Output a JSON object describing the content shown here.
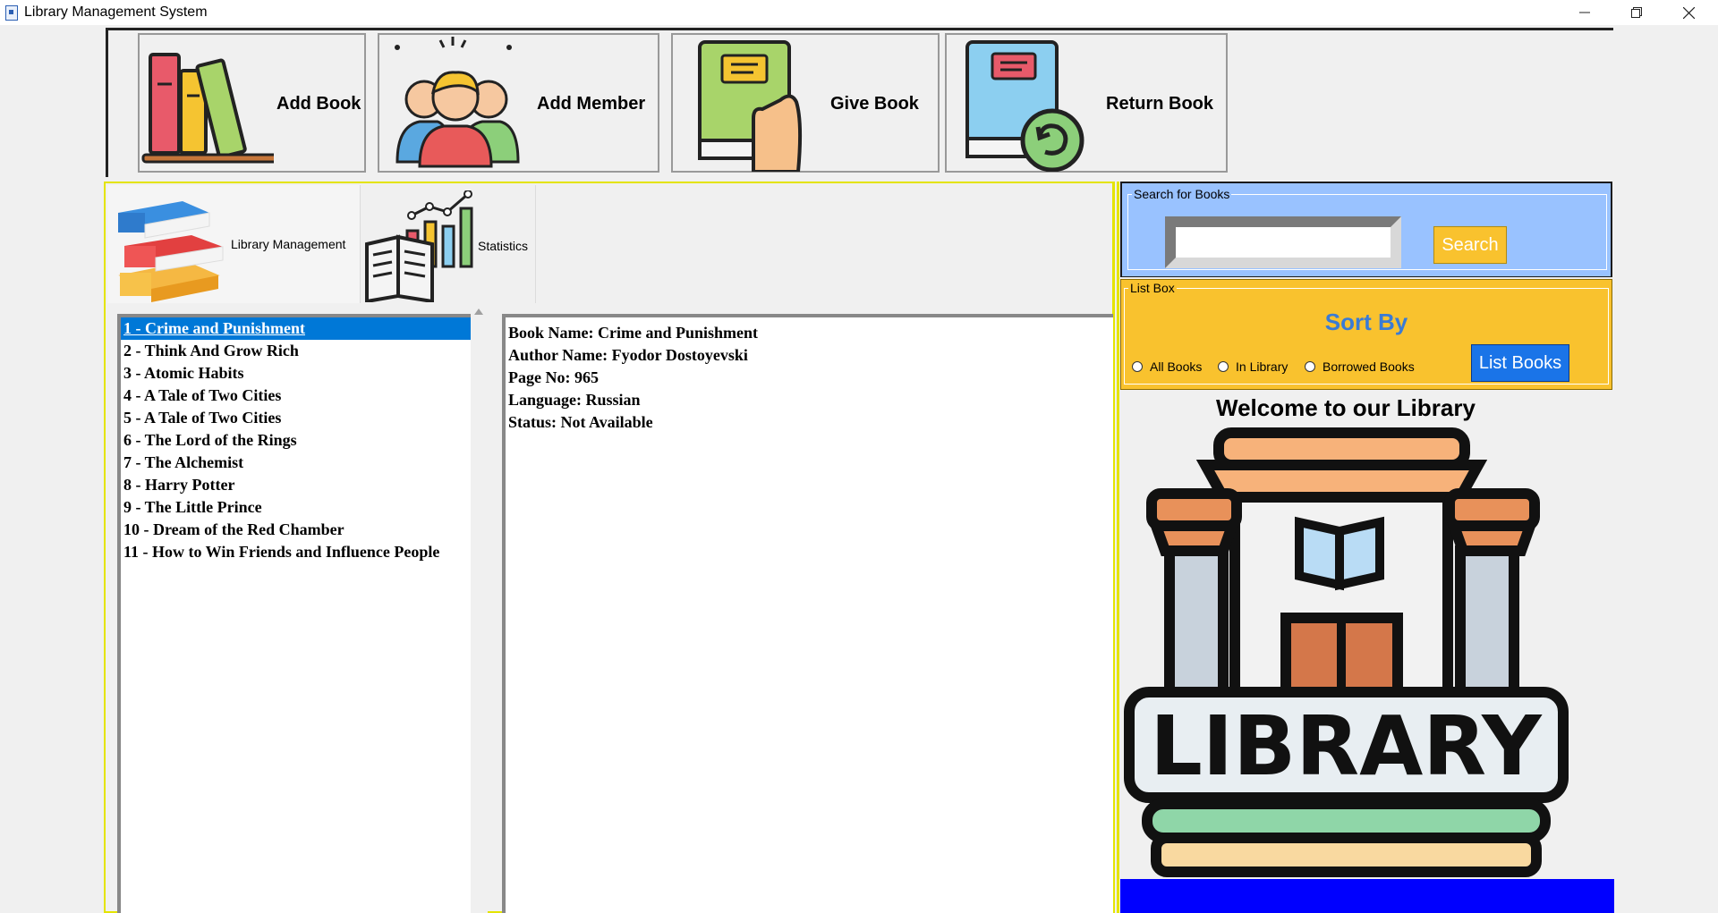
{
  "window": {
    "title": "Library Management System",
    "controls": [
      "minimize",
      "restore",
      "close"
    ]
  },
  "toolbar": {
    "buttons": [
      {
        "label": "Add Book",
        "icon": "books-icon"
      },
      {
        "label": "Add Member",
        "icon": "members-icon"
      },
      {
        "label": "Give Book",
        "icon": "give-book-icon"
      },
      {
        "label": "Return Book",
        "icon": "return-book-icon"
      }
    ]
  },
  "tabs": [
    {
      "label": "Library Management",
      "icon": "book-stack-icon"
    },
    {
      "label": "Statistics",
      "icon": "statistics-icon"
    }
  ],
  "book_list": {
    "selected_index": 0,
    "items": [
      "1 - Crime and Punishment",
      "2 - Think And Grow Rich",
      "3 - Atomic Habits",
      "4 - A Tale of Two Cities",
      "5 - A Tale of Two Cities",
      "6 - The Lord of the Rings",
      "7 - The Alchemist",
      "8 - Harry Potter",
      "9 - The Little Prince",
      "10 - Dream of the Red Chamber",
      "11 - How to Win Friends and Influence People"
    ]
  },
  "details": {
    "lines": [
      "Book Name: Crime and Punishment",
      "Author Name: Fyodor Dostoyevski",
      "Page No: 965",
      "Language: Russian",
      "Status: Not Available"
    ]
  },
  "search": {
    "group_label": "Search for Books",
    "value": "",
    "button_label": "Search"
  },
  "list_box": {
    "group_label": "List Box",
    "heading": "Sort By",
    "options": [
      "All Books",
      "In Library",
      "Borrowed Books"
    ],
    "selected_option": null,
    "button_label": "List Books"
  },
  "welcome": {
    "text": "Welcome to our Library",
    "sign_text": "LIBRARY"
  },
  "colors": {
    "search_bg": "#99c2ff",
    "listbox_bg": "#f9c22e",
    "selection": "#0078d7",
    "list_button": "#1a74e8",
    "sort_heading": "#3a7bd5",
    "bottom_bar": "#0000ff",
    "panel_border": "#e4e400"
  }
}
